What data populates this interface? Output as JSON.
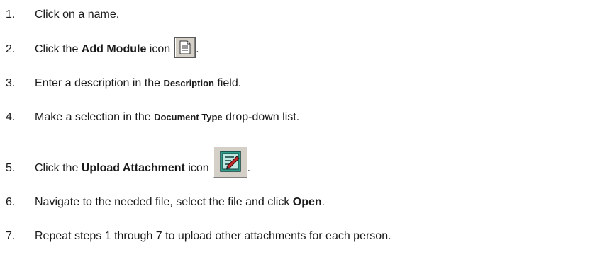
{
  "steps": [
    {
      "number": "1.",
      "text_a": "Click on a name."
    },
    {
      "number": "2.",
      "text_a": "Click the ",
      "bold": "Add Module",
      "text_b": " icon ",
      "icon": "document-icon",
      "text_c": "."
    },
    {
      "number": "3.",
      "text_a": "Enter a description in the ",
      "bold": "Description",
      "text_b": " field."
    },
    {
      "number": "4.",
      "text_a": "Make a selection in the ",
      "bold": "Document Type",
      "text_b": " drop-down list."
    },
    {
      "number": "5.",
      "text_a": "Click the ",
      "bold": "Upload Attachment",
      "text_b": " icon ",
      "icon": "edit-attachment-icon",
      "text_c": "."
    },
    {
      "number": "6.",
      "text_a": "Navigate to the needed file, select the file and click ",
      "bold": "Open",
      "text_b": "."
    },
    {
      "number": "7.",
      "text_a": "Repeat steps 1 through 7 to upload other attachments for each person."
    }
  ],
  "colors": {
    "text": "#1a1a1a",
    "button_face": "#d4d0c8",
    "icon_teal": "#2f9c8c",
    "icon_red": "#c0282a"
  }
}
